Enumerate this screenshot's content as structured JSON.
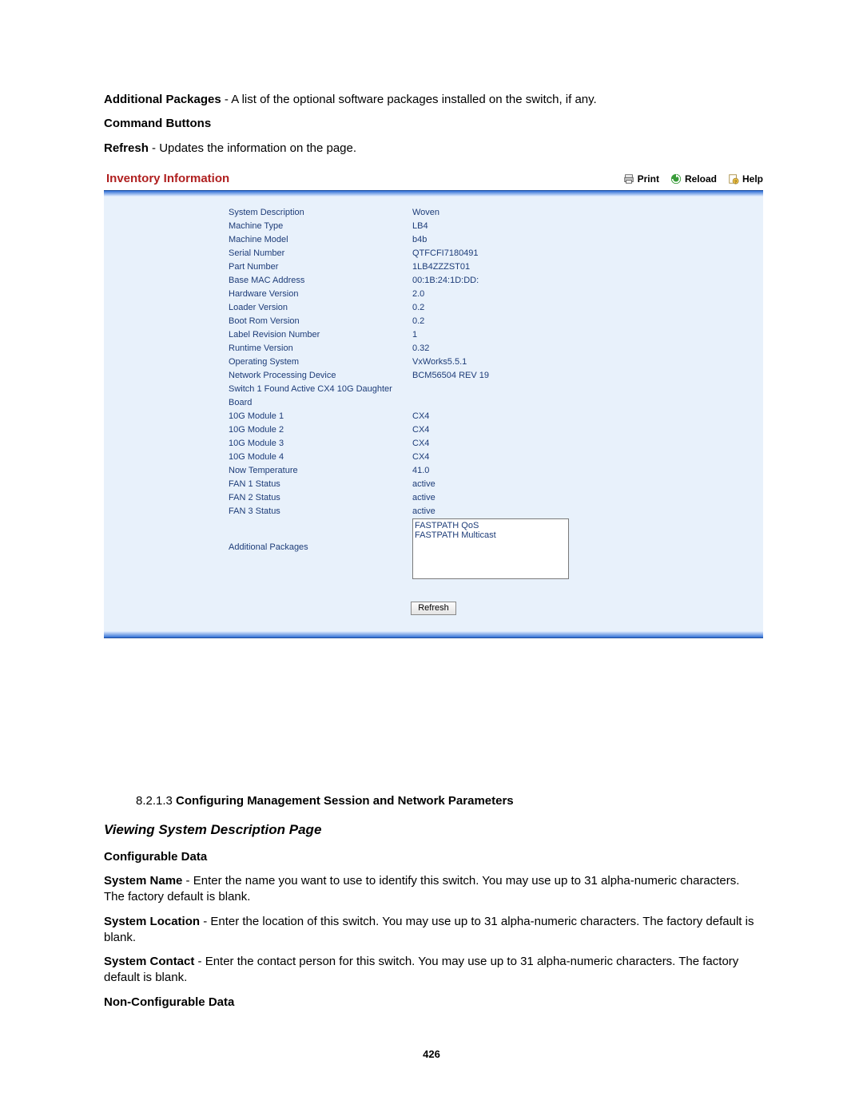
{
  "intro": {
    "ap_term": "Additional Packages",
    "ap_desc": " - A list of the optional software packages installed on the switch, if any.",
    "cmd_head": "Command Buttons",
    "ref_term": "Refresh",
    "ref_desc": " - Updates the information on the page."
  },
  "shot": {
    "title": "Inventory Information",
    "actions": {
      "print": "Print",
      "reload": "Reload",
      "help": "Help"
    },
    "rows": [
      {
        "k": "System Description",
        "v": "Woven"
      },
      {
        "k": "Machine Type",
        "v": "LB4"
      },
      {
        "k": "Machine Model",
        "v": "b4b"
      },
      {
        "k": "Serial Number",
        "v": "QTFCFI7180491"
      },
      {
        "k": "Part Number",
        "v": "1LB4ZZZST01"
      },
      {
        "k": "Base MAC Address",
        "v": "00:1B:24:1D:DD:"
      },
      {
        "k": "Hardware Version",
        "v": "2.0"
      },
      {
        "k": "Loader Version",
        "v": "0.2"
      },
      {
        "k": "Boot Rom Version",
        "v": "0.2"
      },
      {
        "k": "Label Revision Number",
        "v": "1"
      },
      {
        "k": "Runtime Version",
        "v": "0.32"
      },
      {
        "k": "Operating System",
        "v": "VxWorks5.5.1"
      },
      {
        "k": "Network Processing Device",
        "v": "BCM56504 REV 19"
      },
      {
        "k": "Switch 1 Found Active CX4 10G Daughter Board",
        "v": ""
      },
      {
        "k": "10G Module 1",
        "v": "CX4"
      },
      {
        "k": "10G Module 2",
        "v": "CX4"
      },
      {
        "k": "10G Module 3",
        "v": "CX4"
      },
      {
        "k": "10G Module 4",
        "v": "CX4"
      },
      {
        "k": "Now Temperature",
        "v": "41.0"
      },
      {
        "k": "FAN 1 Status",
        "v": "active"
      },
      {
        "k": "FAN 2 Status",
        "v": "active"
      },
      {
        "k": "FAN 3 Status",
        "v": "active"
      }
    ],
    "ap_label": "Additional Packages",
    "ap_value": "FASTPATH QoS\nFASTPATH Multicast",
    "refresh": "Refresh"
  },
  "body": {
    "hnumA": "8.2.1.3 ",
    "hnumB": "Configuring Management Session and Network Parameters",
    "h2": "Viewing System Description Page",
    "cfg_head": "Configurable Data",
    "sn_term": "System Name",
    "sn_desc": " - Enter the name you want to use to identify this switch. You may use up to 31 alpha-numeric characters. The factory default is blank.",
    "sl_term": "System Location",
    "sl_desc": " - Enter the location of this switch. You may use up to 31 alpha-numeric characters. The factory default is blank.",
    "sc_term": "System Contact",
    "sc_desc": " - Enter the contact person for this switch. You may use up to 31 alpha-numeric characters. The factory default is blank.",
    "ncfg_head": "Non-Configurable Data"
  },
  "pagenum": "426"
}
